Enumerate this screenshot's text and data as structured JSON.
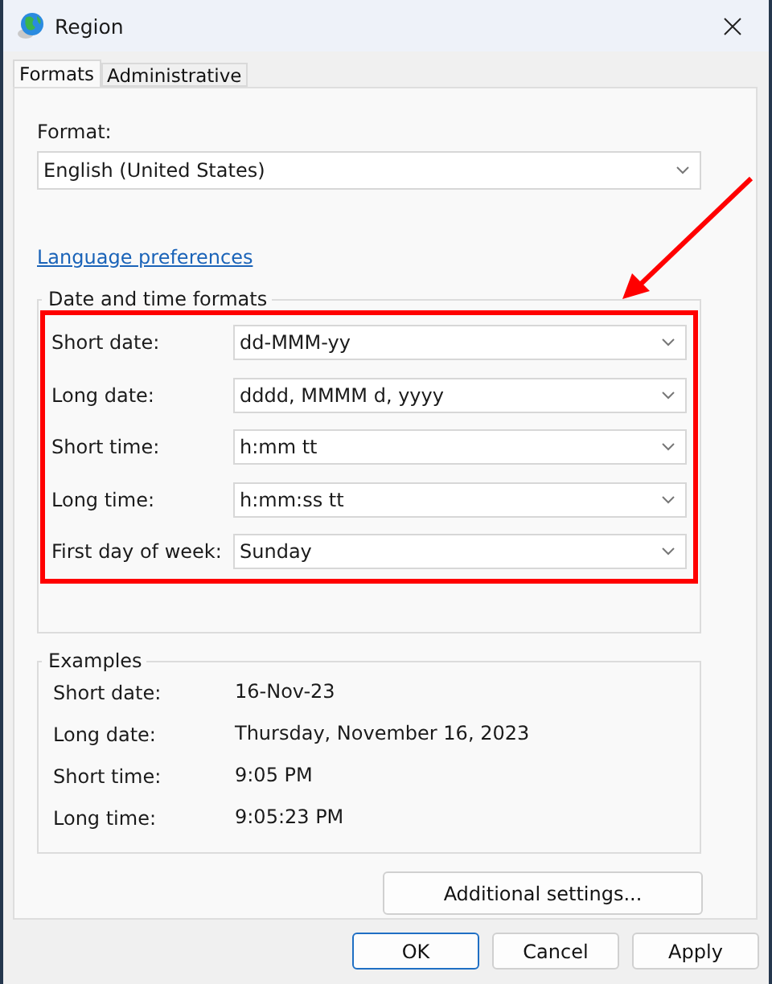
{
  "window": {
    "title": "Region"
  },
  "tabs": [
    {
      "label": "Formats",
      "selected": true
    },
    {
      "label": "Administrative",
      "selected": false
    }
  ],
  "format": {
    "label": "Format:",
    "value": "English (United States)"
  },
  "link": "Language preferences",
  "date_time_formats": {
    "title": "Date and time formats",
    "rows": [
      {
        "label": "Short date:",
        "value": "dd-MMM-yy"
      },
      {
        "label": "Long date:",
        "value": "dddd, MMMM d, yyyy"
      },
      {
        "label": "Short time:",
        "value": "h:mm tt"
      },
      {
        "label": "Long time:",
        "value": "h:mm:ss tt"
      },
      {
        "label": "First day of week:",
        "value": "Sunday"
      }
    ]
  },
  "examples": {
    "title": "Examples",
    "rows": [
      {
        "label": "Short date:",
        "value": "16-Nov-23"
      },
      {
        "label": "Long date:",
        "value": "Thursday, November 16, 2023"
      },
      {
        "label": "Short time:",
        "value": "9:05 PM"
      },
      {
        "label": "Long time:",
        "value": "9:05:23 PM"
      }
    ]
  },
  "additional_button": "Additional settings...",
  "buttons": [
    {
      "label": "OK",
      "default": true
    },
    {
      "label": "Cancel",
      "default": false
    },
    {
      "label": "Apply",
      "default": false
    }
  ]
}
